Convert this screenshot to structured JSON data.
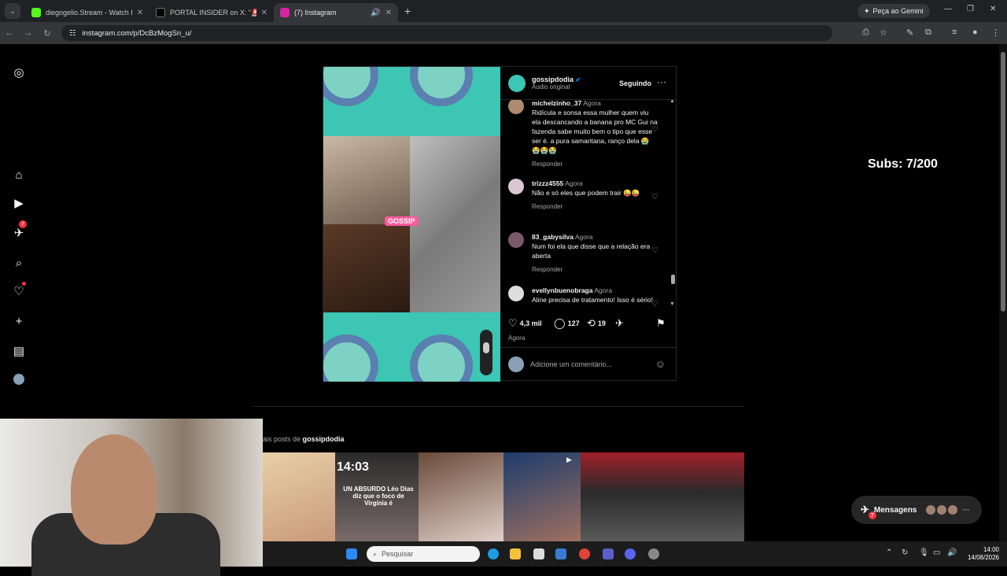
{
  "browser": {
    "tab_menu_icon": "chevron-down-icon",
    "tabs": [
      {
        "title": "diegogelio.Stream - Watch Live",
        "color": "#53fc18"
      },
      {
        "title": "PORTAL INSIDER on X: \"🚨 Vaza",
        "color": "#000000"
      },
      {
        "title": "(7) Instagram",
        "color": "#d6249f"
      }
    ],
    "gemini_label": "Peça ao Gemini",
    "url": "instagram.com/p/DcBzMogSn_u/"
  },
  "post": {
    "username": "gossipdodia",
    "audio": "Áudio original",
    "follow_label": "Seguindo",
    "overlay_tag": "GOSSIP",
    "comments": [
      {
        "user": "michelzinho_37",
        "time": "Agora",
        "text": "Ridícula e sonsa essa mulher quem viu ela descancando a banana pro MC Gui na fazenda sabe muito bem o tipo que esse ser é. a pura samaritana, ranço dela 😭😭😭😭",
        "reply": "Responder"
      },
      {
        "user": "trizzz4555",
        "time": "Agora",
        "text": "Não e só eles que podem trair 😜😜",
        "reply": "Responder"
      },
      {
        "user": "83_gabysilva",
        "time": "Agora",
        "text": "Num foi ela que disse que a relação era aberta",
        "reply": "Responder"
      },
      {
        "user": "evellynbuenobraga",
        "time": "Agora",
        "text": "Aline precisa de tratamento! Isso é sério!",
        "reply": ""
      }
    ],
    "likes": "4,3 mil",
    "comments_count": "127",
    "reposts": "19",
    "posted": "Agora",
    "add_comment_placeholder": "Adicione um comentário..."
  },
  "overlay": {
    "subs": "Subs: 7/200"
  },
  "more_posts": {
    "prefix": "ais posts de",
    "user": "gossipdodia",
    "thumb_text": "14:03",
    "thumb_caption": "UN ABSURDO Léo Dias diz que o foco de Virgínia é"
  },
  "messages": {
    "label": "Mensagens",
    "badge": "7"
  },
  "sidebar": {
    "notification_badge": "7"
  },
  "taskbar": {
    "search_placeholder": "Pesquisar",
    "time": "14:00",
    "date": "14/08/2026"
  }
}
